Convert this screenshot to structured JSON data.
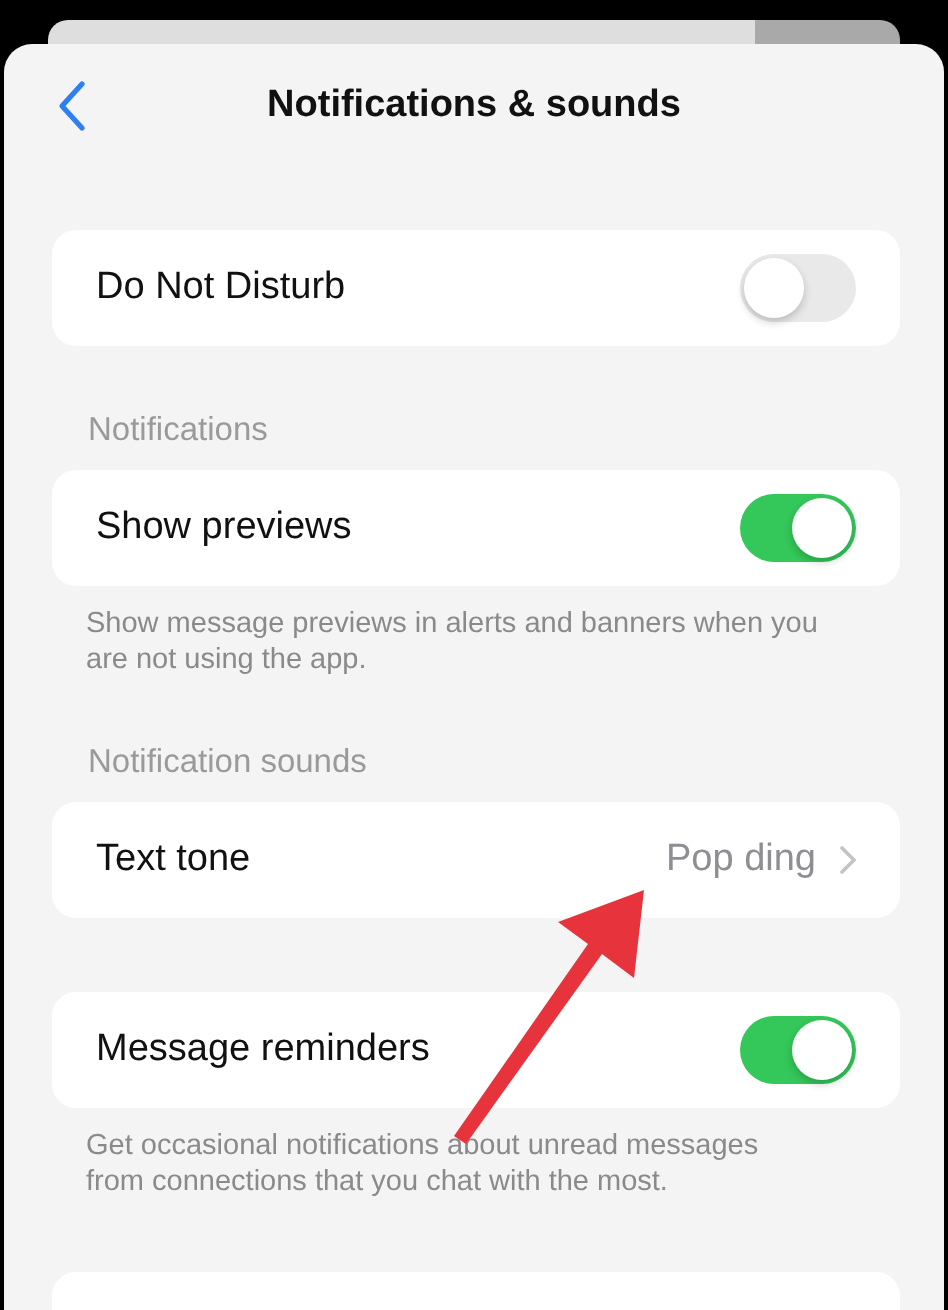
{
  "header": {
    "title": "Notifications & sounds"
  },
  "sections": [
    {
      "rows": [
        {
          "kind": "toggle",
          "label": "Do Not Disturb",
          "on": false
        }
      ]
    },
    {
      "header": "Notifications",
      "rows": [
        {
          "kind": "toggle",
          "label": "Show previews",
          "on": true
        }
      ],
      "footer": "Show message previews in alerts and banners when you are not using the app."
    },
    {
      "header": "Notification sounds",
      "rows": [
        {
          "kind": "link",
          "label": "Text tone",
          "value": "Pop ding"
        }
      ]
    },
    {
      "rows": [
        {
          "kind": "toggle",
          "label": "Message reminders",
          "on": true
        }
      ],
      "footer": "Get occasional notifications about unread messages from connections that you chat with the most."
    }
  ]
}
